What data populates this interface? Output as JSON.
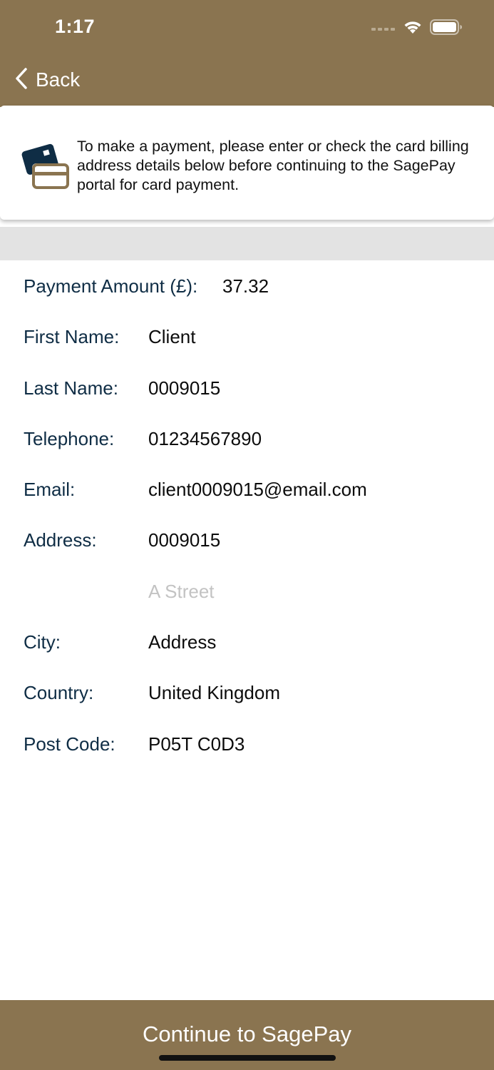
{
  "status_bar": {
    "time": "1:17"
  },
  "nav": {
    "back_label": "Back"
  },
  "info": {
    "text": "To make a payment, please enter or check the card billing address details below before continuing to the SagePay portal for card payment.",
    "icon": "credit-card-icon"
  },
  "form": {
    "payment_amount_label": "Payment Amount (£):",
    "payment_amount_value": "37.32",
    "first_name_label": "First Name:",
    "first_name_value": "Client",
    "last_name_label": "Last Name:",
    "last_name_value": "0009015",
    "telephone_label": "Telephone:",
    "telephone_value": "01234567890",
    "email_label": "Email:",
    "email_value": "client0009015@email.com",
    "address_label": "Address:",
    "address_line1_value": "0009015",
    "address_line2_placeholder": "A Street",
    "city_label": "City:",
    "city_value": "Address",
    "country_label": "Country:",
    "country_value": "United Kingdom",
    "postcode_label": "Post Code:",
    "postcode_value": "P05T C0D3"
  },
  "footer": {
    "continue_label": "Continue to SagePay"
  },
  "colors": {
    "brand": "#8a7450",
    "label": "#0f2d45",
    "icon_dark": "#0f2d45"
  }
}
